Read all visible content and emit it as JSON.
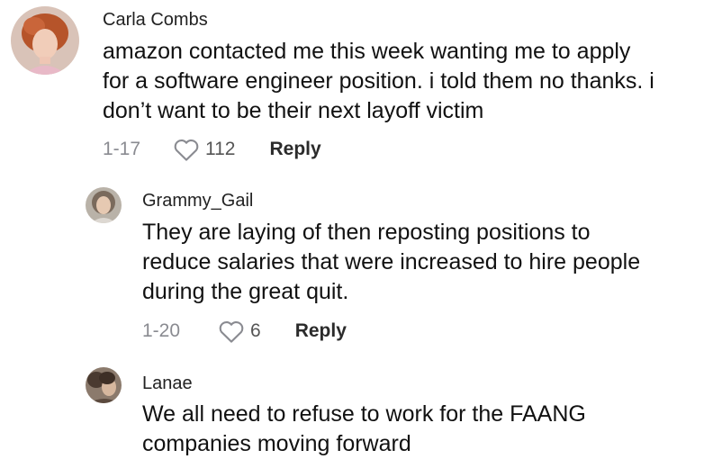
{
  "comments": [
    {
      "username": "Carla Combs",
      "lines": [
        "amazon contacted me this week wanting me to apply",
        "for a software engineer position. i told them no thanks. i",
        "don’t want to be their next layoff victim"
      ],
      "date": "1-17",
      "likes": "112",
      "reply_label": "Reply",
      "avatar_icon": "avatar-photo-icon"
    },
    {
      "username": "Grammy_Gail",
      "lines": [
        "They are laying of then reposting positions to",
        "reduce salaries that were increased to hire people",
        "during the great quit."
      ],
      "date": "1-20",
      "likes": "6",
      "reply_label": "Reply",
      "avatar_icon": "avatar-photo-icon"
    },
    {
      "username": "Lanae",
      "lines": [
        "We all need to refuse to work for the FAANG",
        "companies moving forward"
      ],
      "avatar_icon": "avatar-photo-icon"
    }
  ],
  "icons": {
    "like": "heart-outline-icon"
  },
  "colors": {
    "text": "#111111",
    "meta": "#8a8b91",
    "reply": "#2b2b2b",
    "background": "#ffffff"
  }
}
